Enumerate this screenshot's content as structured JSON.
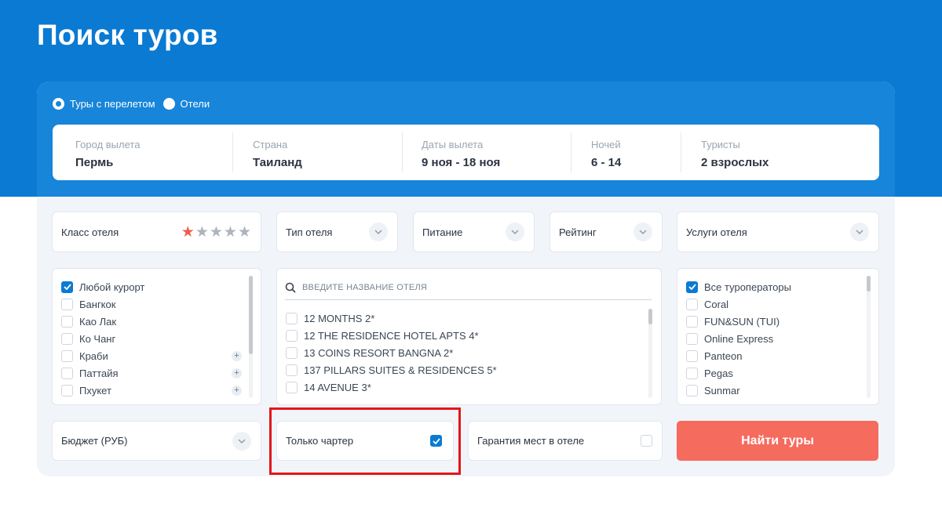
{
  "page": {
    "title": "Поиск туров"
  },
  "mode": {
    "options": [
      "Туры с перелетом",
      "Отели"
    ],
    "selected": "Туры с перелетом"
  },
  "search": {
    "city": {
      "label": "Город вылета",
      "value": "Пермь"
    },
    "country": {
      "label": "Страна",
      "value": "Таиланд"
    },
    "dates": {
      "label": "Даты вылета",
      "value": "9 ноя - 18 ноя"
    },
    "nights": {
      "label": "Ночей",
      "value": "6 - 14"
    },
    "tourists": {
      "label": "Туристы",
      "value": "2 взрослых"
    }
  },
  "filters": {
    "hotel_class": {
      "label": "Класс отеля",
      "stars_total": 5,
      "stars_selected": 1
    },
    "hotel_type": {
      "label": "Тип отеля"
    },
    "meal": {
      "label": "Питание"
    },
    "rating": {
      "label": "Рейтинг"
    },
    "services": {
      "label": "Услуги отеля"
    }
  },
  "resorts": [
    {
      "label": "Любой курорт",
      "checked": true,
      "expandable": false
    },
    {
      "label": "Бангкок",
      "checked": false,
      "expandable": false
    },
    {
      "label": "Као Лак",
      "checked": false,
      "expandable": false
    },
    {
      "label": "Ко Чанг",
      "checked": false,
      "expandable": false
    },
    {
      "label": "Краби",
      "checked": false,
      "expandable": true
    },
    {
      "label": "Паттайя",
      "checked": false,
      "expandable": true
    },
    {
      "label": "Пхукет",
      "checked": false,
      "expandable": true
    }
  ],
  "hotels": {
    "placeholder": "Введите название отеля",
    "items": [
      "12 MONTHS 2*",
      "12 THE RESIDENCE HOTEL APTS 4*",
      "13 COINS RESORT BANGNA 2*",
      "137 PILLARS SUITES & RESIDENCES 5*",
      "14 AVENUE 3*"
    ]
  },
  "operators": [
    {
      "label": "Все туроператоры",
      "checked": true
    },
    {
      "label": "Coral",
      "checked": false
    },
    {
      "label": "FUN&SUN (TUI)",
      "checked": false
    },
    {
      "label": "Online Express",
      "checked": false
    },
    {
      "label": "Panteon",
      "checked": false
    },
    {
      "label": "Pegas",
      "checked": false
    },
    {
      "label": "Sunmar",
      "checked": false
    }
  ],
  "bottom": {
    "budget": {
      "label": "Бюджет (РУБ)"
    },
    "charter": {
      "label": "Только чартер",
      "checked": true
    },
    "guarantee": {
      "label": "Гарантия мест в отеле",
      "checked": false
    },
    "find_label": "Найти туры"
  },
  "colors": {
    "header": "#0a7ad3",
    "accent": "#f56b5e",
    "highlight": "#e3161b"
  }
}
